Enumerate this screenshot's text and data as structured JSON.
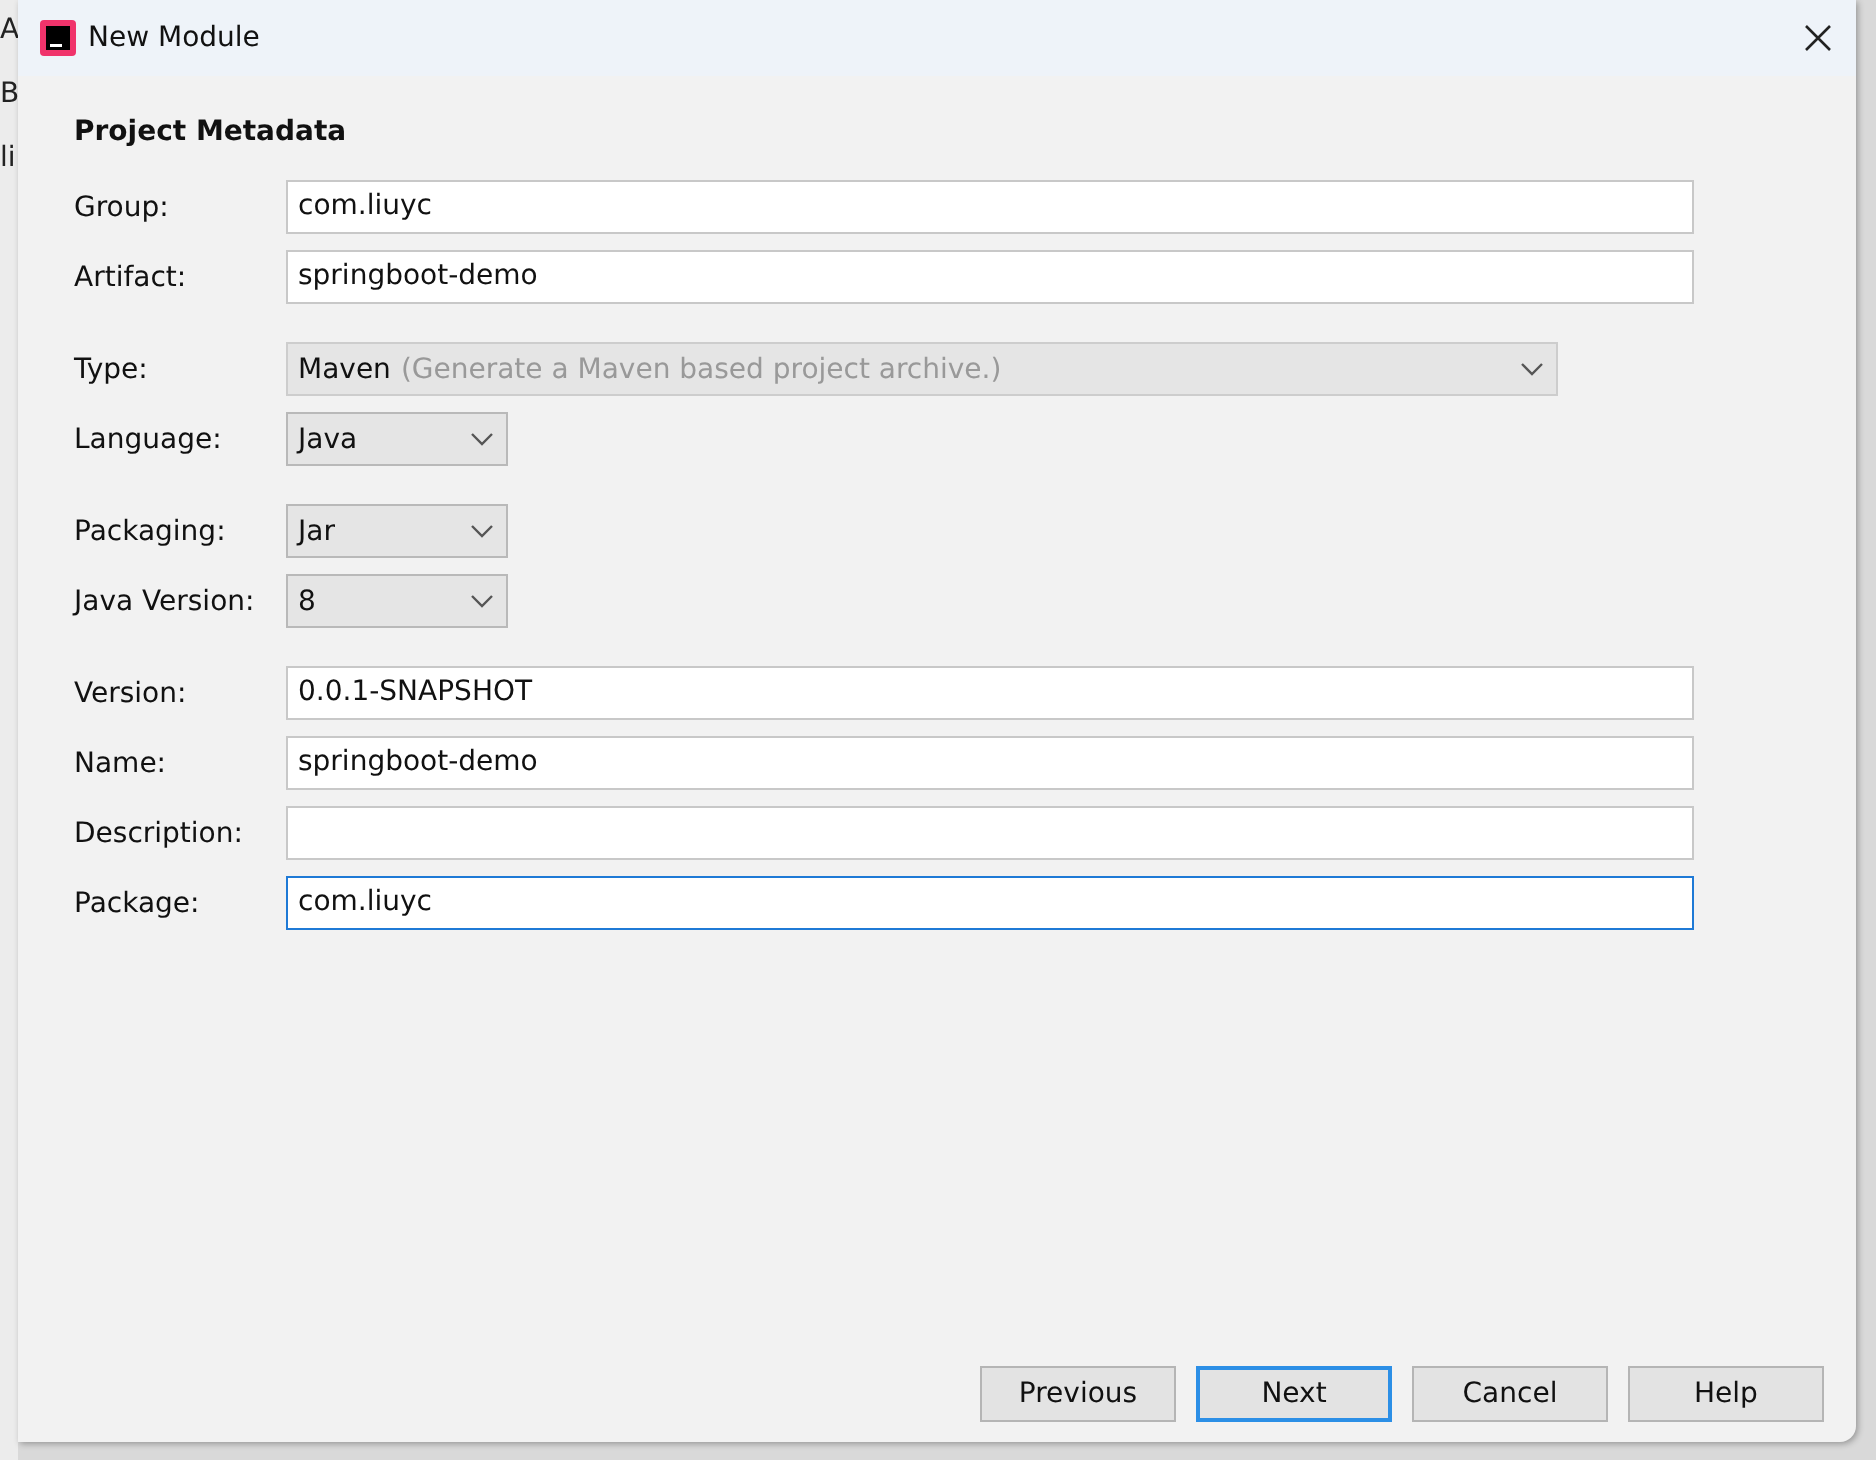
{
  "background_fragments": [
    "A",
    "B",
    "li"
  ],
  "window": {
    "title": "New Module"
  },
  "section_title": "Project Metadata",
  "groups": [
    [
      {
        "label": "Group:",
        "kind": "text",
        "value": "com.liuyc",
        "focused": false
      },
      {
        "label": "Artifact:",
        "kind": "text",
        "value": "springboot-demo",
        "focused": false
      }
    ],
    [
      {
        "label": "Type:",
        "kind": "wide_combo",
        "value": "Maven",
        "hint": "(Generate a Maven based project archive.)",
        "disabled": true
      },
      {
        "label": "Language:",
        "kind": "combo",
        "value": "Java",
        "disabled": false
      }
    ],
    [
      {
        "label": "Packaging:",
        "kind": "combo",
        "value": "Jar",
        "disabled": false
      },
      {
        "label": "Java Version:",
        "kind": "combo",
        "value": "8",
        "disabled": false
      }
    ],
    [
      {
        "label": "Version:",
        "kind": "text",
        "value": "0.0.1-SNAPSHOT",
        "focused": false
      },
      {
        "label": "Name:",
        "kind": "text",
        "value": "springboot-demo",
        "focused": false
      },
      {
        "label": "Description:",
        "kind": "text",
        "focused": false
      },
      {
        "label": "Package:",
        "kind": "text",
        "value": "com.liuyc",
        "focused": true
      }
    ]
  ],
  "buttons": [
    {
      "label": "Previous",
      "default": false
    },
    {
      "label": "Next",
      "default": true
    },
    {
      "label": "Cancel",
      "default": false
    },
    {
      "label": "Help",
      "default": false
    }
  ]
}
